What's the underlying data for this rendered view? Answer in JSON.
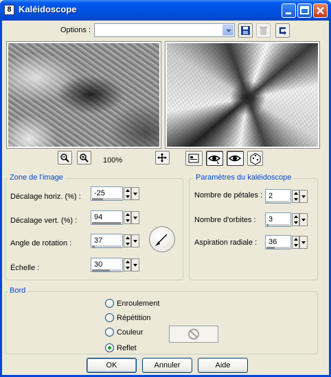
{
  "window": {
    "title": "Kaléidoscope",
    "icon_text": "8",
    "controls": [
      "minimize",
      "maximize",
      "close"
    ]
  },
  "options": {
    "label": "Options :",
    "value": "",
    "icons": [
      "save-icon",
      "delete-icon",
      "reset-icon"
    ]
  },
  "preview": {
    "zoom_label": "100%",
    "tools": [
      "zoom-out-icon",
      "zoom-in-icon",
      "move-icon",
      "proof-icon",
      "auto-proof-icon",
      "eye-icon",
      "random-dice-icon"
    ]
  },
  "zone": {
    "title": "Zone de l'image",
    "fields": [
      {
        "label": "Décalage horiz. (%) :",
        "value": "-25",
        "level": 0.375
      },
      {
        "label": "Décalage vert. (%) :",
        "value": "94",
        "level": 0.97
      },
      {
        "label": "Angle de rotation :",
        "value": "37",
        "level": 0.1
      },
      {
        "label": "Échelle :",
        "value": "30",
        "level": 0.6
      }
    ]
  },
  "params": {
    "title": "Paramètres du kaléidoscope",
    "fields": [
      {
        "label": "Nombre de pétales :",
        "value": "2",
        "level": 0.03
      },
      {
        "label": "Nombre d'orbites :",
        "value": "3",
        "level": 0.1
      },
      {
        "label": "Aspiration radiale :",
        "value": "36",
        "level": 0.36
      }
    ]
  },
  "bord": {
    "title": "Bord",
    "options": [
      "Enroulement",
      "Répétition",
      "Couleur",
      "Reflet"
    ],
    "selected": "Reflet"
  },
  "buttons": {
    "ok": "OK",
    "cancel": "Annuler",
    "help": "Aide"
  }
}
